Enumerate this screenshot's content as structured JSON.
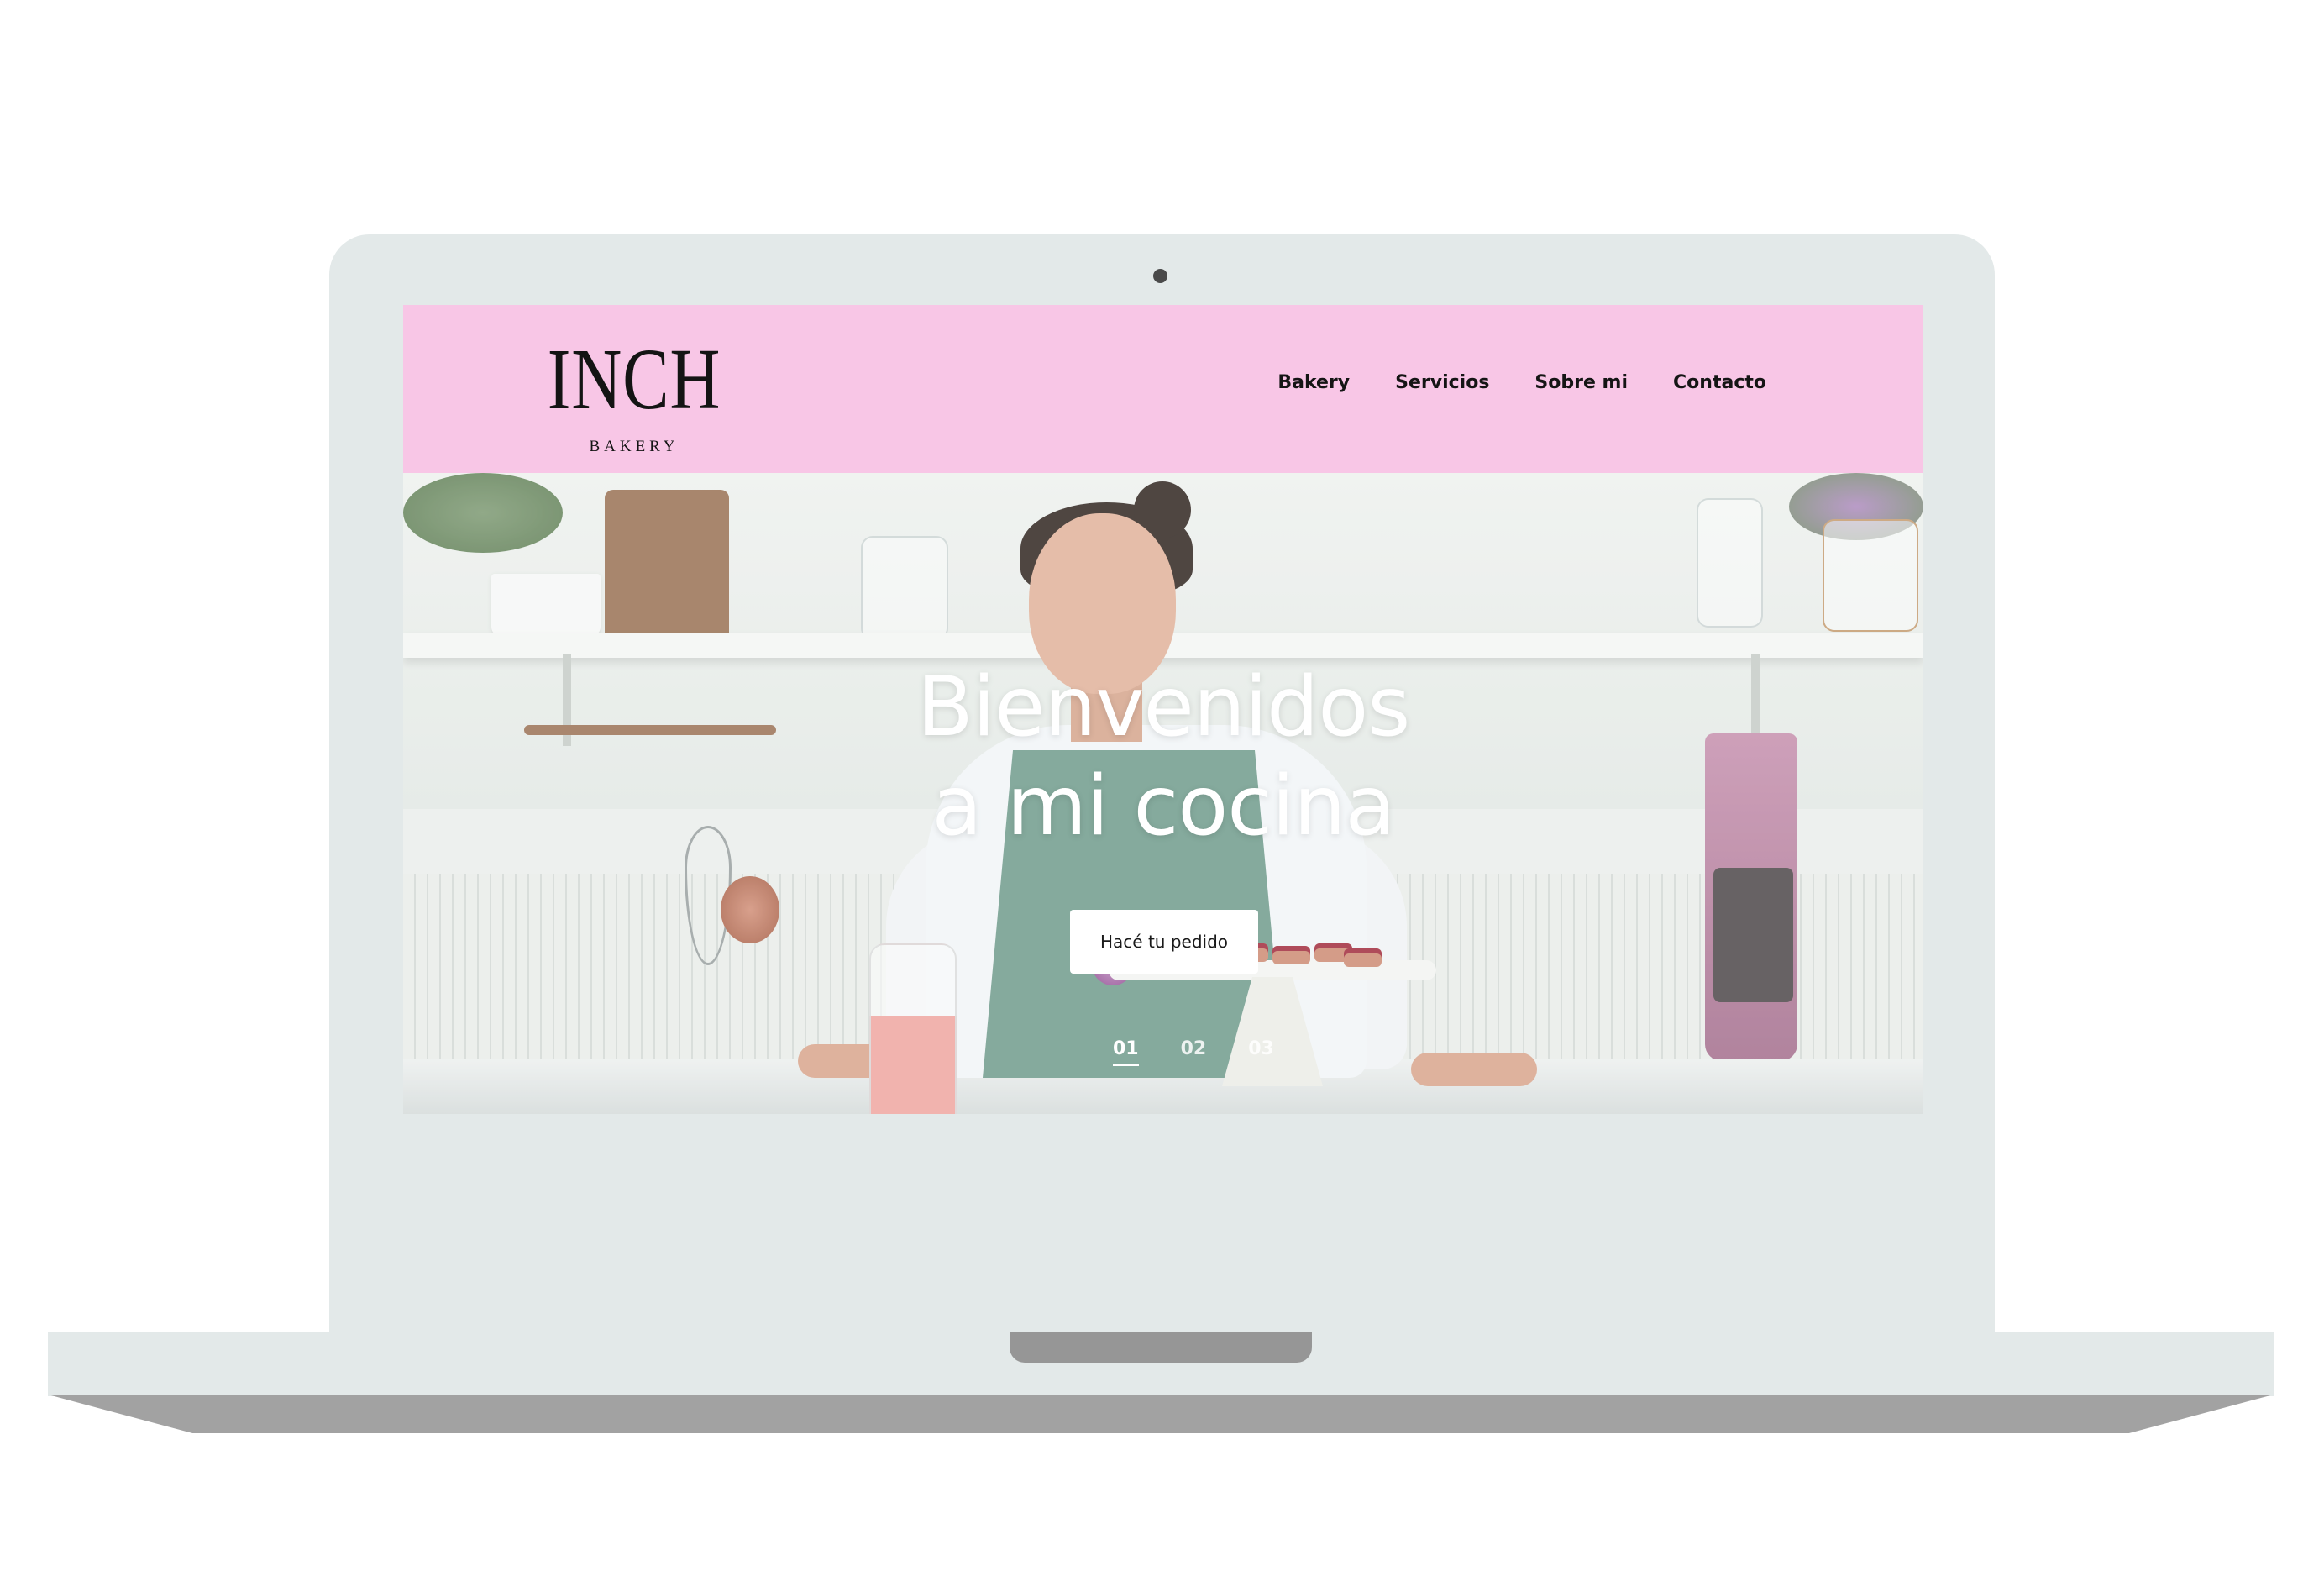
{
  "site": {
    "logo": {
      "name": "INCH",
      "tagline": "BAKERY"
    },
    "nav": [
      "Bakery",
      "Servicios",
      "Sobre mi",
      "Contacto"
    ],
    "hero": {
      "title_line1": "Bienvenidos",
      "title_line2": "a mi cocina",
      "cta_label": "Hacé tu pedido",
      "slides": [
        "01",
        "02",
        "03"
      ],
      "active_slide": "01"
    },
    "colors": {
      "header_bg": "#f8c6e6",
      "laptop_body": "#e3e9e9",
      "text_dark": "#151515",
      "cta_bg": "#ffffff"
    }
  }
}
